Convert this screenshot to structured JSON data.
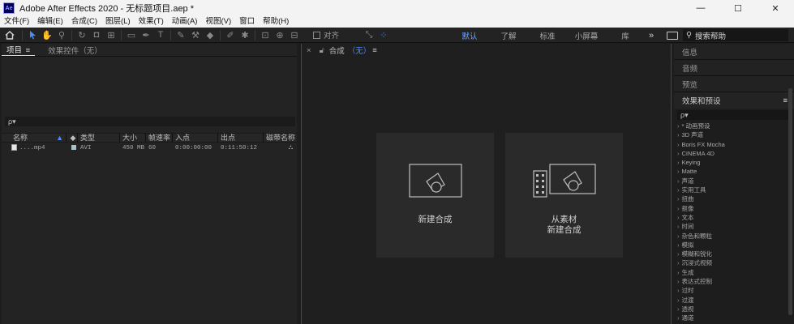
{
  "window": {
    "app_icon": "Ae",
    "title": "Adobe After Effects 2020 - 无标题项目.aep *",
    "controls": [
      "—",
      "☐",
      "✕"
    ]
  },
  "menu": [
    "文件(F)",
    "编辑(E)",
    "合成(C)",
    "图层(L)",
    "效果(T)",
    "动画(A)",
    "视图(V)",
    "窗口",
    "帮助(H)"
  ],
  "toolbar": {
    "snap_label": "对齐",
    "workspaces": [
      "默认",
      "了解",
      "标准",
      "小屏幕",
      "库"
    ],
    "active_workspace": "默认",
    "more": "»",
    "search_help": "搜索帮助"
  },
  "project_panel": {
    "tab_project": "项目",
    "tab_effect_controls": "效果控件（无）",
    "menu_glyph": "≡",
    "search_icon": "ρ▾",
    "columns": [
      "名称",
      "类型",
      "大小",
      "帧速率",
      "入点",
      "出点",
      "磁带名称"
    ],
    "rows": [
      {
        "name": "....mp4",
        "type": "AVI",
        "size": "450 MB",
        "fps": "60",
        "in": "0:00:00:00",
        "out": "0:11:50:12"
      }
    ]
  },
  "comp_panel": {
    "close": "×",
    "label": "合成",
    "none": "（无）",
    "menu_glyph": "≡",
    "card_new_comp": "新建合成",
    "card_from_footage_1": "从素材",
    "card_from_footage_2": "新建合成"
  },
  "right_panel": {
    "info": "信息",
    "audio": "音频",
    "preview": "预览",
    "effects_presets": "效果和预设",
    "menu_glyph": "≡",
    "search_icon": "ρ▾",
    "effects": [
      "* 动画预设",
      "3D 声道",
      "Boris FX Mocha",
      "CINEMA 4D",
      "Keying",
      "Matte",
      "声道",
      "实用工具",
      "扭曲",
      "抠像",
      "文本",
      "时间",
      "杂色和颗粒",
      "模拟",
      "模糊和锐化",
      "沉浸式视频",
      "生成",
      "表达式控制",
      "过时",
      "过渡",
      "透视",
      "通道"
    ]
  },
  "colors": {
    "accent": "#4d8cff",
    "panel_bg": "#232323",
    "card_bg": "#2a2a2a"
  }
}
